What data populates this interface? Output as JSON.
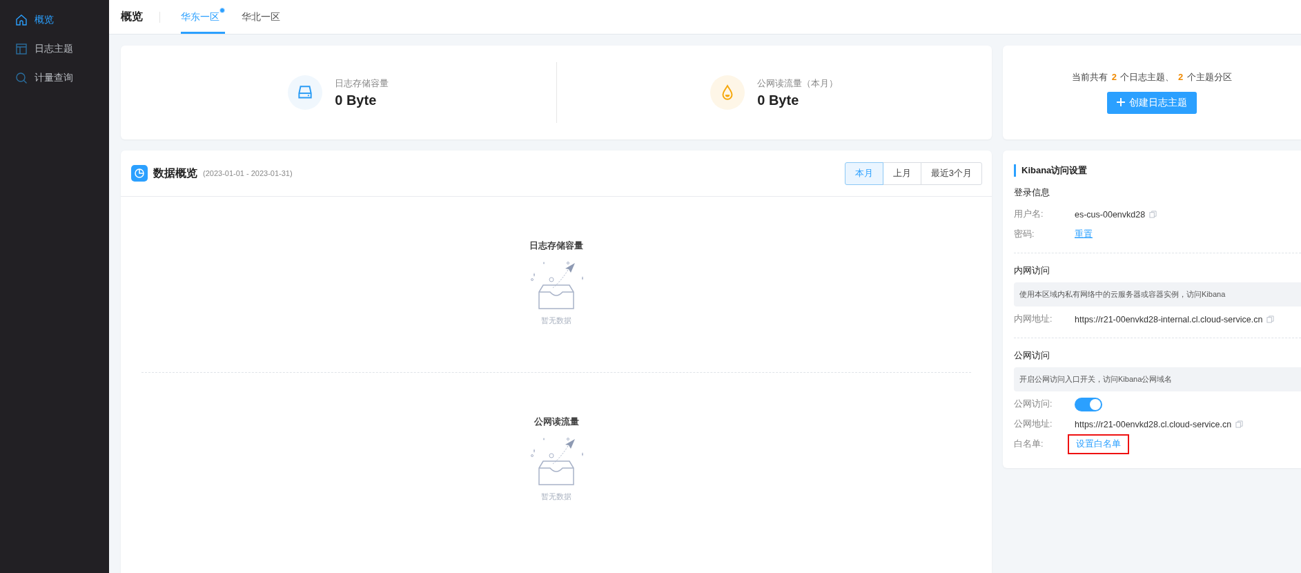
{
  "sidebar": {
    "items": [
      {
        "label": "概览",
        "kind": "home",
        "selected": true
      },
      {
        "label": "日志主题",
        "kind": "layout",
        "selected": false
      },
      {
        "label": "计量查询",
        "kind": "search",
        "selected": false
      }
    ]
  },
  "header": {
    "title": "概览",
    "tabs": [
      {
        "label": "华东一区",
        "selected": true,
        "dot": true
      },
      {
        "label": "华北一区",
        "selected": false,
        "dot": false
      }
    ]
  },
  "stats": [
    {
      "kind": "storage",
      "label": "日志存储容量",
      "value": "0 Byte"
    },
    {
      "kind": "traffic",
      "label": "公网读流量（本月）",
      "value": "0 Byte"
    }
  ],
  "summary": {
    "text": "当前共有 **2** 个日志主题、 **2** 个主题分区",
    "button": "创建日志主题"
  },
  "overview": {
    "title": "数据概览",
    "range": "(2023-01-01 - 2023-01-31)",
    "periods": [
      {
        "label": "本月",
        "selected": true
      },
      {
        "label": "上月",
        "selected": false
      },
      {
        "label": "最近3个月",
        "selected": false
      }
    ],
    "panels": [
      {
        "title": "日志存储容量",
        "empty": "暂无数据"
      },
      {
        "title": "公网读流量",
        "empty": "暂无数据"
      }
    ]
  },
  "kibana": {
    "title": "Kibana访问设置",
    "login": {
      "heading": "登录信息",
      "username_label": "用户名:",
      "username": "es-cus-00envkd28",
      "password_label": "密码:",
      "reset": "重置"
    },
    "intranet": {
      "heading": "内网访问",
      "note": "使用本区域内私有网络中的云服务器或容器实例，访问Kibana",
      "address_label": "内网地址:",
      "address": "https://r21-00envkd28-internal.cl.cloud-service.cn"
    },
    "public": {
      "heading": "公网访问",
      "note": "开启公网访问入口开关，访问Kibana公网域名",
      "switch_label": "公网访问:",
      "on": true,
      "address_label": "公网地址:",
      "address": "https://r21-00envkd28.cl.cloud-service.cn",
      "whitelist_label": "白名单:",
      "whitelist": "设置白名单",
      "highlighted": true
    }
  }
}
